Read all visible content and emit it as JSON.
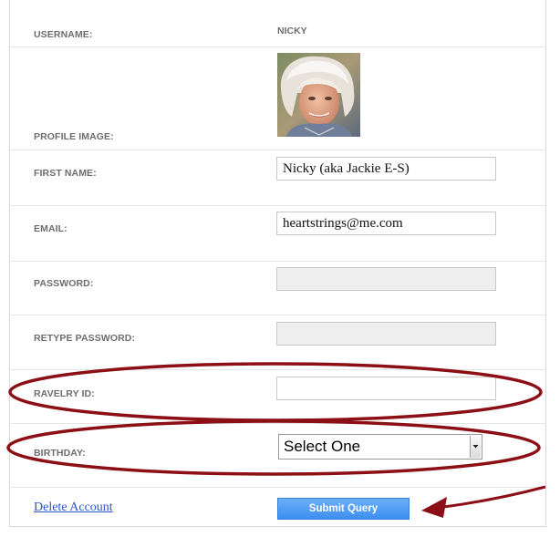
{
  "form": {
    "username": {
      "label": "USERNAME:",
      "value": "NICKY"
    },
    "profile_image": {
      "label": "PROFILE IMAGE:"
    },
    "first_name": {
      "label": "FIRST NAME:",
      "value": "Nicky (aka Jackie E-S)"
    },
    "email": {
      "label": "EMAIL:",
      "value": "heartstrings@me.com"
    },
    "password": {
      "label": "PASSWORD:",
      "value": ""
    },
    "retype_password": {
      "label": "RETYPE PASSWORD:",
      "value": ""
    },
    "ravelry_id": {
      "label": "RAVELRY ID:",
      "value": ""
    },
    "birthday": {
      "label": "BIRTHDAY:",
      "selected": "Select One"
    }
  },
  "actions": {
    "delete_label": "Delete Account",
    "submit_label": "Submit Query"
  },
  "colors": {
    "annotation": "#8b0f14",
    "link": "#2a55c7",
    "button": "#4a97f3"
  },
  "icons": {
    "select_arrow": "chevron-down-icon",
    "annotation_arrow": "arrow-left-icon"
  }
}
